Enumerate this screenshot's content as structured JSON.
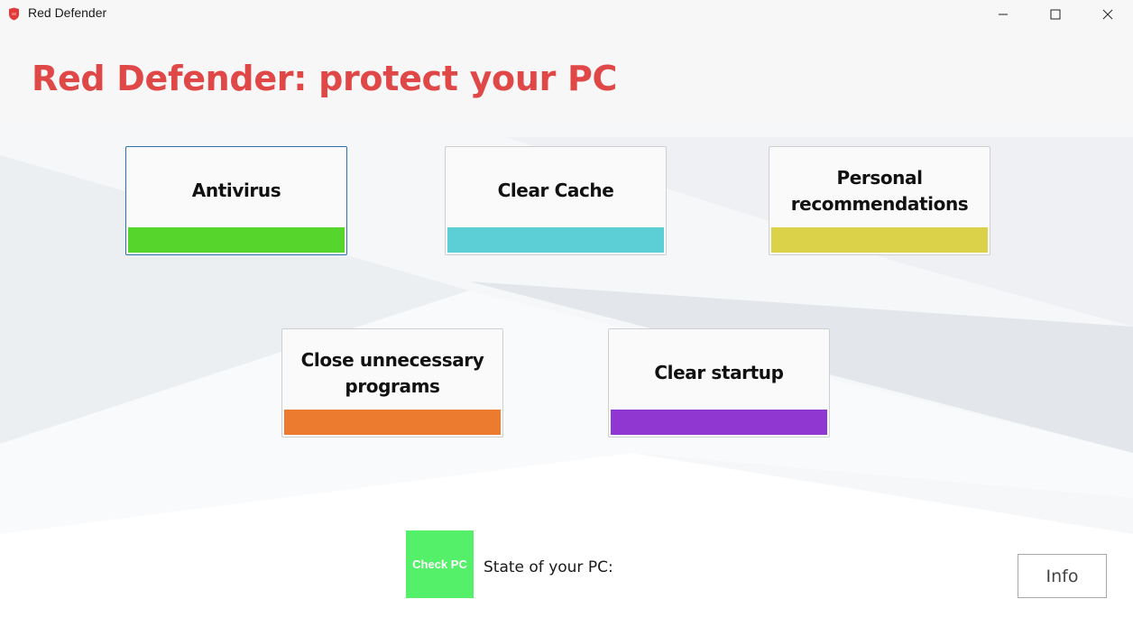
{
  "window": {
    "title": "Red Defender",
    "icon": "shield-icon",
    "controls": [
      "minimize-icon",
      "maximize-icon",
      "close-icon"
    ]
  },
  "header": {
    "title": "Red Defender: protect your PC",
    "title_color": "#e04848"
  },
  "cards": [
    {
      "label": "Antivirus",
      "bar_color": "#56d52c",
      "focused": true
    },
    {
      "label": "Clear Cache",
      "bar_color": "#5ccfd6",
      "focused": false
    },
    {
      "label": "Personal recommendations",
      "bar_color": "#dcd24a",
      "focused": false
    },
    {
      "label": "Close unnecessary programs",
      "bar_color": "#ec7b2f",
      "focused": false
    },
    {
      "label": "Clear startup",
      "bar_color": "#8f37d0",
      "focused": false
    }
  ],
  "check": {
    "label": "Check PC",
    "color": "#54f06a"
  },
  "state": {
    "label": "State of your PC:"
  },
  "info": {
    "label": "Info"
  }
}
